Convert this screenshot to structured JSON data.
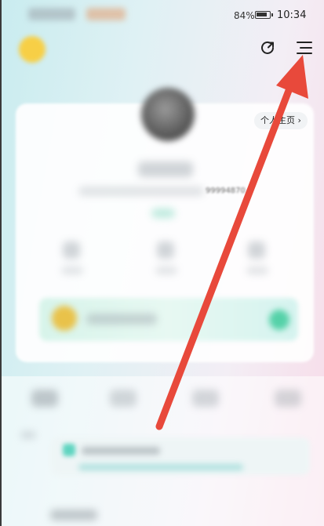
{
  "status_bar": {
    "battery_percent": "84%",
    "time": "10:34"
  },
  "header": {
    "share_icon": "share-refresh-icon",
    "menu_icon": "hamburger-menu-icon"
  },
  "profile": {
    "home_link_label": "个人主页 ›",
    "id_suffix": "99994870"
  },
  "colors": {
    "annotation_arrow": "#e8493b",
    "accent_teal": "#55d1a8"
  }
}
